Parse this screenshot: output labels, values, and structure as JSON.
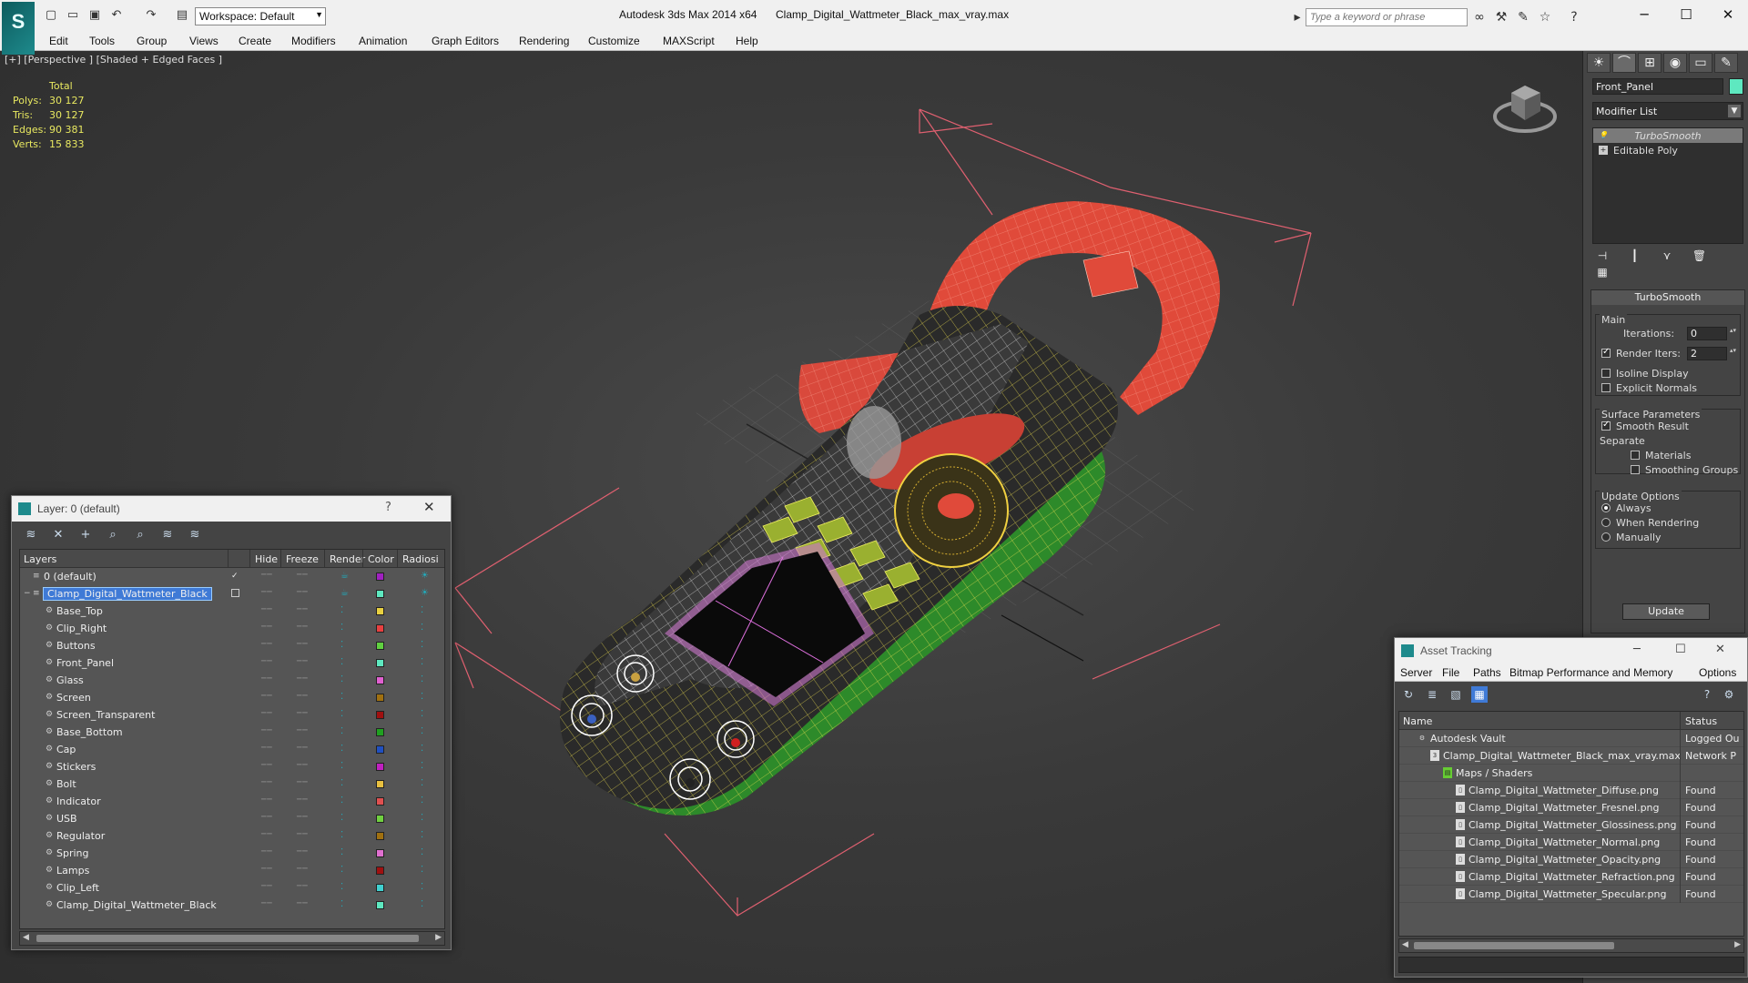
{
  "titlebar": {
    "workspace": "Workspace: Default",
    "app_title": "Autodesk 3ds Max  2014 x64",
    "file_name": "Clamp_Digital_Wattmeter_Black_max_vray.max",
    "search_placeholder": "Type a keyword or phrase"
  },
  "menu": [
    "Edit",
    "Tools",
    "Group",
    "Views",
    "Create",
    "Modifiers",
    "Animation",
    "Graph Editors",
    "Rendering",
    "Customize",
    "MAXScript",
    "Help"
  ],
  "viewport": {
    "label": "[+] [Perspective ] [Shaded + Edged Faces ]",
    "stats": {
      "header": "Total",
      "rows": [
        {
          "label": "Polys:",
          "value": "30 127"
        },
        {
          "label": "Tris:",
          "value": "30 127"
        },
        {
          "label": "Edges:",
          "value": "90 381"
        },
        {
          "label": "Verts:",
          "value": "15 833"
        }
      ]
    }
  },
  "command_panel": {
    "object_name": "Front_Panel",
    "object_color": "#5ee8c0",
    "modifier_list": "Modifier List",
    "stack": [
      "TurboSmooth",
      "Editable Poly"
    ],
    "rollout_title": "TurboSmooth",
    "main_label": "Main",
    "iterations_label": "Iterations:",
    "iterations_value": "0",
    "render_iters_label": "Render Iters:",
    "render_iters_value": "2",
    "isoline_label": "Isoline Display",
    "explicit_label": "Explicit Normals",
    "surface_label": "Surface Parameters",
    "smooth_result_label": "Smooth Result",
    "separate_label": "Separate",
    "materials_label": "Materials",
    "smoothing_groups_label": "Smoothing Groups",
    "update_options_label": "Update Options",
    "always_label": "Always",
    "when_rendering_label": "When Rendering",
    "manually_label": "Manually",
    "update_button": "Update"
  },
  "layer_explorer": {
    "title": "Layer: 0 (default)",
    "help": "?",
    "columns": {
      "layers": "Layers",
      "hide": "Hide",
      "freeze": "Freeze",
      "render": "Render",
      "color": "Color",
      "radiosity": "Radiosi"
    },
    "rows": [
      {
        "name": "0 (default)",
        "color": "#a020c0",
        "level": 0
      },
      {
        "name": "Clamp_Digital_Wattmeter_Black",
        "color": "#5ee8c0",
        "level": 0,
        "selected": true
      },
      {
        "name": "Base_Top",
        "color": "#e8d040",
        "level": 1
      },
      {
        "name": "Clip_Right",
        "color": "#e84040",
        "level": 1
      },
      {
        "name": "Buttons",
        "color": "#60d040",
        "level": 1
      },
      {
        "name": "Front_Panel",
        "color": "#5ee8c0",
        "level": 1
      },
      {
        "name": "Glass",
        "color": "#e060d0",
        "level": 1
      },
      {
        "name": "Screen",
        "color": "#a07010",
        "level": 1
      },
      {
        "name": "Screen_Transparent",
        "color": "#a01010",
        "level": 1
      },
      {
        "name": "Base_Bottom",
        "color": "#20a020",
        "level": 1
      },
      {
        "name": "Cap",
        "color": "#2050c0",
        "level": 1
      },
      {
        "name": "Stickers",
        "color": "#c020c0",
        "level": 1
      },
      {
        "name": "Bolt",
        "color": "#e8c040",
        "level": 1
      },
      {
        "name": "Indicator",
        "color": "#e05050",
        "level": 1
      },
      {
        "name": "USB",
        "color": "#70d040",
        "level": 1
      },
      {
        "name": "Regulator",
        "color": "#a07010",
        "level": 1
      },
      {
        "name": "Spring",
        "color": "#e070d0",
        "level": 1
      },
      {
        "name": "Lamps",
        "color": "#a01010",
        "level": 1
      },
      {
        "name": "Clip_Left",
        "color": "#40d0d0",
        "level": 1
      },
      {
        "name": "Clamp_Digital_Wattmeter_Black",
        "color": "#5ee8c0",
        "level": 1
      }
    ]
  },
  "asset_tracking": {
    "title": "Asset Tracking",
    "menu": [
      "Server",
      "File",
      "Paths",
      "Bitmap Performance and Memory",
      "Options"
    ],
    "columns": {
      "name": "Name",
      "status": "Status"
    },
    "rows": [
      {
        "name": "Autodesk Vault",
        "status": "Logged Ou",
        "level": 0,
        "icon": "vault"
      },
      {
        "name": "Clamp_Digital_Wattmeter_Black_max_vray.max",
        "status": "Network P",
        "level": 1,
        "icon": "max"
      },
      {
        "name": "Maps / Shaders",
        "status": "",
        "level": 2,
        "icon": "maps"
      },
      {
        "name": "Clamp_Digital_Wattmeter_Diffuse.png",
        "status": "Found",
        "level": 3,
        "icon": "file"
      },
      {
        "name": "Clamp_Digital_Wattmeter_Fresnel.png",
        "status": "Found",
        "level": 3,
        "icon": "file"
      },
      {
        "name": "Clamp_Digital_Wattmeter_Glossiness.png",
        "status": "Found",
        "level": 3,
        "icon": "file"
      },
      {
        "name": "Clamp_Digital_Wattmeter_Normal.png",
        "status": "Found",
        "level": 3,
        "icon": "file"
      },
      {
        "name": "Clamp_Digital_Wattmeter_Opacity.png",
        "status": "Found",
        "level": 3,
        "icon": "file"
      },
      {
        "name": "Clamp_Digital_Wattmeter_Refraction.png",
        "status": "Found",
        "level": 3,
        "icon": "file"
      },
      {
        "name": "Clamp_Digital_Wattmeter_Specular.png",
        "status": "Found",
        "level": 3,
        "icon": "file"
      }
    ]
  }
}
